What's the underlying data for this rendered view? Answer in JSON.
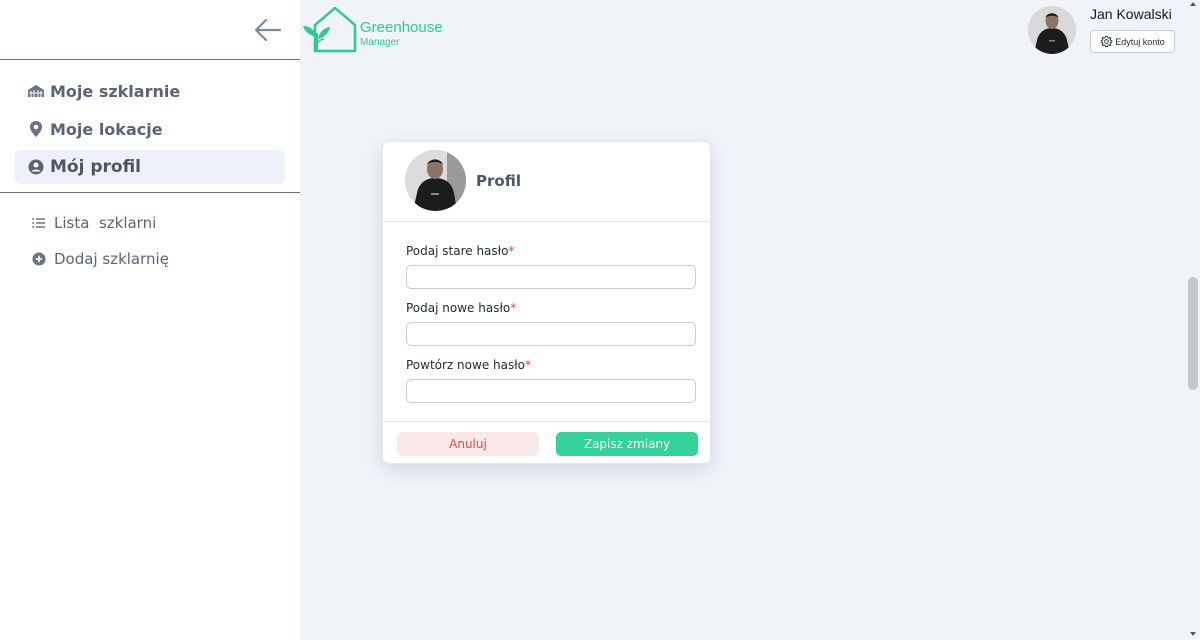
{
  "sidebar": {
    "main_items": [
      {
        "label": "Moje szklarnie",
        "icon": "greenhouse-icon"
      },
      {
        "label": "Moje lokacje",
        "icon": "location-pin-icon"
      },
      {
        "label": "Mój profil",
        "icon": "user-circle-icon",
        "active": true
      }
    ],
    "sub_items": [
      {
        "label": "Lista  szklarni",
        "icon": "list-icon"
      },
      {
        "label": "Dodaj szklarnię",
        "icon": "plus-circle-icon"
      }
    ]
  },
  "logo": {
    "title": "Greenhouse",
    "subtitle": "Manager"
  },
  "user": {
    "name": "Jan Kowalski",
    "edit_label": "Edytuj konto"
  },
  "profile_card": {
    "title": "Profil",
    "fields": [
      {
        "label": "Podaj stare hasło",
        "required": "*",
        "value": ""
      },
      {
        "label": "Podaj nowe hasło",
        "required": "*",
        "value": ""
      },
      {
        "label": "Powtórz nowe hasło",
        "required": "*",
        "value": ""
      }
    ],
    "cancel_label": "Anuluj",
    "save_label": "Zapisz zmiany"
  },
  "colors": {
    "accent": "#34d29a",
    "brand": "#34c98e",
    "danger": "#e04f4f",
    "background": "#f0f3f8"
  }
}
